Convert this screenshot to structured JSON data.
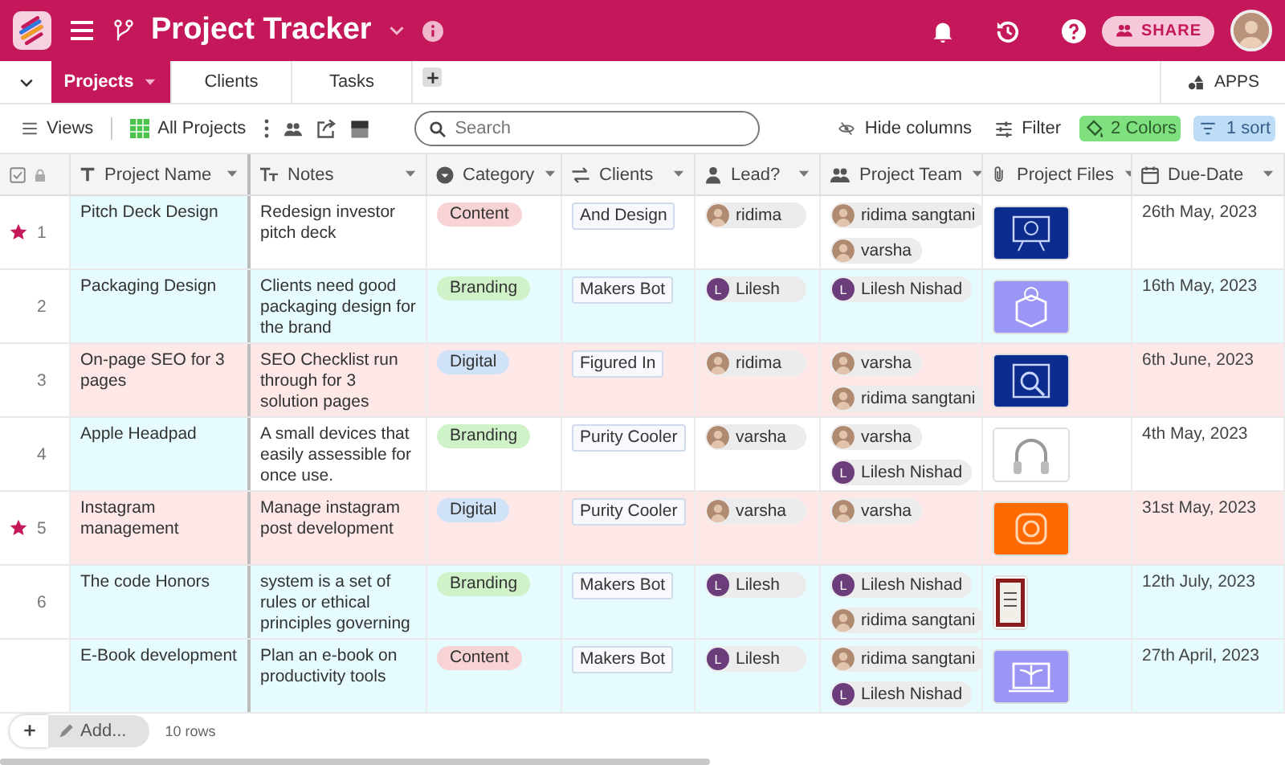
{
  "app": {
    "title": "Project Tracker",
    "share_label": "SHARE"
  },
  "tabs": [
    {
      "label": "Projects",
      "selected": true
    },
    {
      "label": "Clients",
      "selected": false
    },
    {
      "label": "Tasks",
      "selected": false
    }
  ],
  "apps_label": "APPS",
  "toolbar": {
    "views": "Views",
    "view_name": "All Projects",
    "search": {
      "placeholder": "Search"
    },
    "hide_columns": "Hide columns",
    "filter": "Filter",
    "colors": "2 Colors",
    "sort": "1 sort"
  },
  "columns": [
    {
      "label": "Project Name",
      "kind": "text"
    },
    {
      "label": "Notes",
      "kind": "longtext"
    },
    {
      "label": "Category",
      "kind": "select"
    },
    {
      "label": "Clients",
      "kind": "link"
    },
    {
      "label": "Lead?",
      "kind": "user"
    },
    {
      "label": "Project Team",
      "kind": "users"
    },
    {
      "label": "Project Files",
      "kind": "file"
    },
    {
      "label": "Due-Date",
      "kind": "date"
    }
  ],
  "rows": [
    {
      "number": "1",
      "starred": true,
      "color": "#e6fbfd",
      "full_row_color": false,
      "name": "Pitch Deck Design",
      "notes": "Redesign investor pitch deck",
      "category": {
        "label": "Content",
        "color": "#f8d3d5"
      },
      "client": "And Design",
      "lead": {
        "name": "ridima"
      },
      "team": [
        {
          "name": "ridima sangtani"
        },
        {
          "name": "varsha"
        }
      ],
      "files": [
        {
          "kind": "picture"
        }
      ],
      "due": "26th May, 2023"
    },
    {
      "number": "2",
      "starred": false,
      "color": "#e6fbfd",
      "full_row_color": true,
      "name": "Packaging Design",
      "notes": "Clients need good packaging design for the brand",
      "category": {
        "label": "Branding",
        "color": "#cff2c8"
      },
      "client": "Makers Bot",
      "lead": {
        "name": "Lilesh",
        "kind": "initial",
        "initial": "L"
      },
      "team": [
        {
          "name": "Lilesh Nishad",
          "kind": "initial",
          "initial": "L"
        }
      ],
      "files": [
        {
          "kind": "picture"
        }
      ],
      "due": "16th May, 2023"
    },
    {
      "number": "3",
      "starred": false,
      "color": "#fde7e7",
      "full_row_color": true,
      "name": "On-page SEO for 3 pages",
      "notes": "SEO Checklist run through for 3 solution pages",
      "category": {
        "label": "Digital",
        "color": "#cfe2f8"
      },
      "client": "Figured In",
      "lead": {
        "name": "ridima"
      },
      "team": [
        {
          "name": "varsha"
        },
        {
          "name": "ridima sangtani"
        }
      ],
      "files": [
        {
          "kind": "picture"
        }
      ],
      "due": "6th June, 2023"
    },
    {
      "number": "4",
      "starred": false,
      "color": "#e6fbfd",
      "full_row_color": false,
      "name": "Apple Headpad",
      "notes": "A small devices that easily assessible for once use.",
      "category": {
        "label": "Branding",
        "color": "#cff2c8"
      },
      "client": "Purity Cooler",
      "lead": {
        "name": "varsha"
      },
      "team": [
        {
          "name": "varsha"
        },
        {
          "name": "Lilesh Nishad",
          "kind": "initial",
          "initial": "L"
        }
      ],
      "files": [
        {
          "kind": "picture"
        }
      ],
      "due": "4th May, 2023"
    },
    {
      "number": "5",
      "starred": true,
      "color": "#fde7e7",
      "full_row_color": true,
      "name": "Instagram management",
      "notes": "Manage instagram post development",
      "category": {
        "label": "Digital",
        "color": "#cfe2f8"
      },
      "client": "Purity Cooler",
      "lead": {
        "name": "varsha"
      },
      "team": [
        {
          "name": "varsha"
        }
      ],
      "files": [
        {
          "kind": "picture"
        }
      ],
      "due": "31st May, 2023"
    },
    {
      "number": "6",
      "starred": false,
      "color": "#e6fbfd",
      "full_row_color": true,
      "name": "The code Honors",
      "notes": "system is a set of rules or ethical principles governing",
      "category": {
        "label": "Branding",
        "color": "#cff2c8"
      },
      "client": "Makers Bot",
      "lead": {
        "name": "Lilesh",
        "kind": "initial",
        "initial": "L"
      },
      "team": [
        {
          "name": "Lilesh Nishad",
          "kind": "initial",
          "initial": "L"
        },
        {
          "name": "ridima sangtani"
        }
      ],
      "files": [
        {
          "kind": "picture"
        }
      ],
      "due": "12th July, 2023"
    },
    {
      "starred": false,
      "color": "#e6fbfd",
      "full_row_color": true,
      "name": "E-Book development",
      "notes": "Plan an e-book on productivity tools",
      "category": {
        "label": "Content",
        "color": "#f8d3d5"
      },
      "client": "Makers Bot",
      "lead": {
        "name": "Lilesh",
        "kind": "initial",
        "initial": "L"
      },
      "team": [
        {
          "name": "ridima sangtani"
        },
        {
          "name": "Lilesh Nishad",
          "kind": "initial",
          "initial": "L"
        }
      ],
      "files": [
        {
          "kind": "picture"
        }
      ],
      "due": "27th April, 2023"
    }
  ],
  "footer": {
    "add_label": "Add...",
    "row_count": "10 rows"
  }
}
